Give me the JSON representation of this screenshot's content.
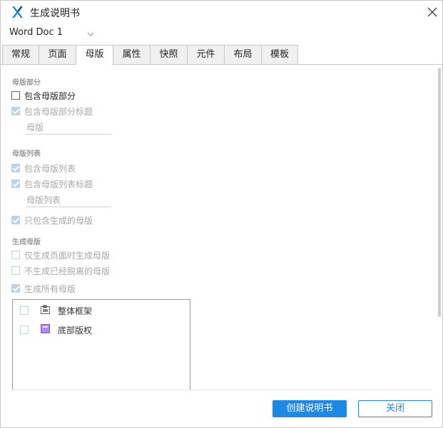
{
  "window": {
    "title": "生成说明书",
    "accent_color": "#1e88e5",
    "logo_icon": "axure-x-icon",
    "close_icon": "close-icon"
  },
  "document": {
    "selected": "Word Doc 1",
    "chevron_icon": "chevron-down-icon"
  },
  "tabs": [
    {
      "label": "常规",
      "active": false
    },
    {
      "label": "页面",
      "active": false
    },
    {
      "label": "母版",
      "active": true
    },
    {
      "label": "属性",
      "active": false
    },
    {
      "label": "快照",
      "active": false
    },
    {
      "label": "元件",
      "active": false
    },
    {
      "label": "布局",
      "active": false
    },
    {
      "label": "模板",
      "active": false
    }
  ],
  "master_section": {
    "title": "母版部分",
    "include_section": {
      "label": "包含母版部分",
      "checked": false,
      "enabled": true
    },
    "include_title": {
      "label": "包含母版部分标题",
      "checked": true,
      "enabled": false
    },
    "title_placeholder": "母版"
  },
  "master_list_section": {
    "title": "母版列表",
    "include_list": {
      "label": "包含母版列表",
      "checked": true,
      "enabled": false
    },
    "include_list_title": {
      "label": "包含母版列表标题",
      "checked": true,
      "enabled": false
    },
    "list_title_placeholder": "母版列表",
    "only_generated": {
      "label": "只包含生成的母版",
      "checked": true,
      "enabled": false
    }
  },
  "generate_section": {
    "title": "生成母版",
    "only_when_page": {
      "label": "仅生成页面时生成母版",
      "checked": false,
      "enabled": false
    },
    "not_detached": {
      "label": "不生成已经脱离的母版",
      "checked": false,
      "enabled": false
    },
    "all_masters": {
      "label": "生成所有母版",
      "checked": true,
      "enabled": false
    }
  },
  "masters": [
    {
      "label": "整体框架",
      "icon": "master-frame-icon",
      "checked": false
    },
    {
      "label": "底部版权",
      "icon": "master-footer-icon",
      "checked": false
    }
  ],
  "footer": {
    "create_label": "创建说明书",
    "close_label": "关闭"
  }
}
